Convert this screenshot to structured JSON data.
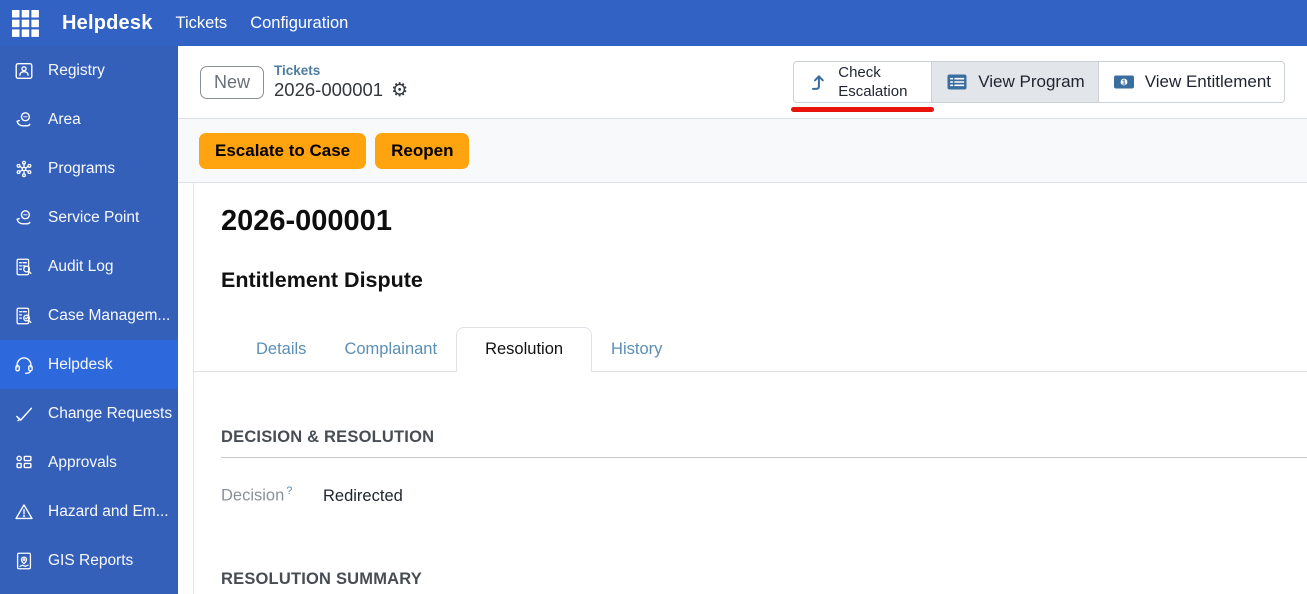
{
  "topbar": {
    "brand": "Helpdesk",
    "menu": [
      {
        "label": "Tickets"
      },
      {
        "label": "Configuration"
      }
    ]
  },
  "sidebar": {
    "items": [
      {
        "label": "Registry",
        "icon": "registry-card-icon",
        "active": false
      },
      {
        "label": "Area",
        "icon": "hand-globe-icon",
        "active": false
      },
      {
        "label": "Programs",
        "icon": "network-icon",
        "active": false
      },
      {
        "label": "Service Point",
        "icon": "hand-globe-icon",
        "active": false
      },
      {
        "label": "Audit Log",
        "icon": "audit-checklist-icon",
        "active": false
      },
      {
        "label": "Case Managem...",
        "icon": "case-checklist-icon",
        "active": false
      },
      {
        "label": "Helpdesk",
        "icon": "headset-icon",
        "active": true
      },
      {
        "label": "Change Requests",
        "icon": "check-swoosh-icon",
        "active": false
      },
      {
        "label": "Approvals",
        "icon": "kanban-icon",
        "active": false
      },
      {
        "label": "Hazard and Em...",
        "icon": "warning-triangle-icon",
        "active": false
      },
      {
        "label": "GIS Reports",
        "icon": "map-report-icon",
        "active": false
      }
    ]
  },
  "header": {
    "status_badge": "New",
    "breadcrumb_parent": "Tickets",
    "breadcrumb_current": "2026-000001",
    "gear_icon": "⚙",
    "actions": [
      {
        "label": "Check Escalation",
        "icon": "arrow-turn-up-icon",
        "annotated": true
      },
      {
        "label": "View Program",
        "icon": "list-icon",
        "annotated": false
      },
      {
        "label": "View Entitlement",
        "icon": "banknote-icon",
        "annotated": false
      }
    ],
    "annotation": {
      "color": "#e8130d",
      "target": "Check Escalation"
    }
  },
  "statusbar": {
    "buttons": [
      {
        "label": "Escalate to Case"
      },
      {
        "label": "Reopen"
      }
    ]
  },
  "sheet": {
    "title": "2026-000001",
    "subtitle": "Entitlement Dispute",
    "tabs": [
      {
        "label": "Details",
        "active": false
      },
      {
        "label": "Complainant",
        "active": false
      },
      {
        "label": "Resolution",
        "active": true
      },
      {
        "label": "History",
        "active": false
      }
    ],
    "section1": {
      "heading": "DECISION & RESOLUTION"
    },
    "fields": [
      {
        "label": "Decision",
        "help_marker": "?",
        "value": "Redirected"
      }
    ],
    "section2": {
      "heading": "RESOLUTION SUMMARY"
    }
  },
  "colors": {
    "topbar_blue": "#3263c4",
    "sidebar_blue": "#3560b9",
    "sidebar_active_blue": "#2d68dd",
    "action_orange": "#ffa30f",
    "annotation_red": "#e8130d",
    "link_steel_blue": "#5b8fb5",
    "button_icon_blue": "#3a6e9f"
  }
}
